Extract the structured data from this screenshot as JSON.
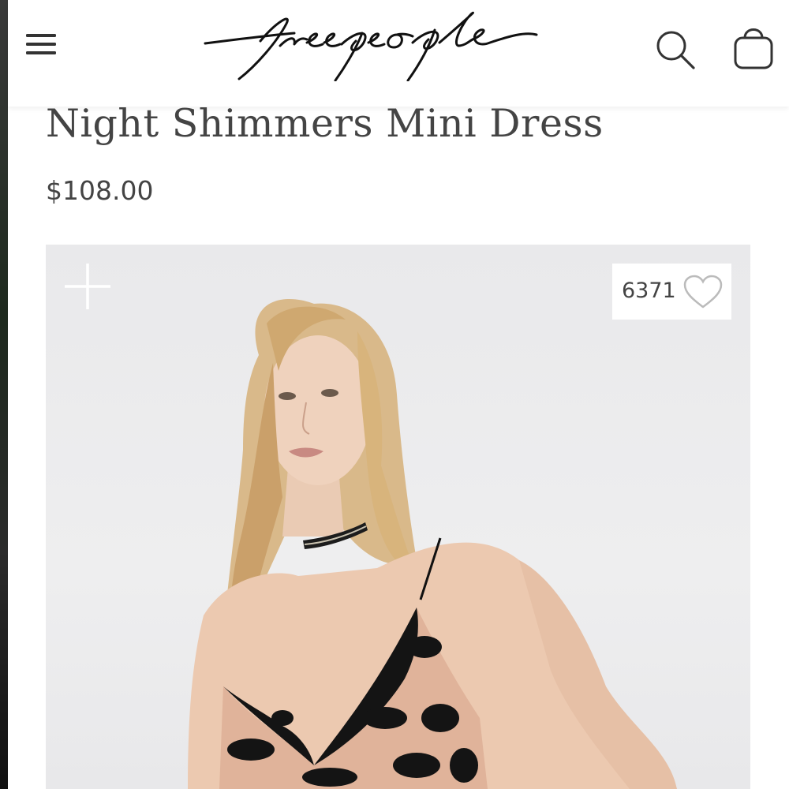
{
  "header": {
    "menu_icon": "hamburger-menu-icon",
    "logo_text": "free people",
    "search_icon": "search-icon",
    "bag_icon": "shopping-bag-icon"
  },
  "product": {
    "title": "Night Shimmers Mini Dress",
    "price": "$108.00"
  },
  "image_overlay": {
    "zoom_icon": "plus-icon",
    "like_count": "6371",
    "like_icon": "heart-icon"
  },
  "colors": {
    "text": "#444444",
    "image_background": "#ebebed",
    "header_background": "#ffffff"
  }
}
